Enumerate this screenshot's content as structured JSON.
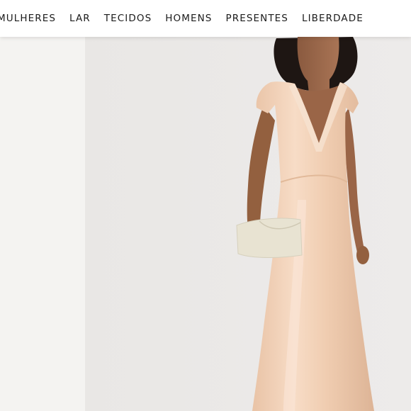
{
  "nav": {
    "items": [
      {
        "label": "MULHERES"
      },
      {
        "label": "LAR"
      },
      {
        "label": "TECIDOS"
      },
      {
        "label": "HOMENS"
      },
      {
        "label": "PRESENTES"
      },
      {
        "label": "LIBERDADE"
      }
    ]
  },
  "product": {
    "dress_color": "#f3d2b8",
    "bag_color": "#e8e3d2",
    "background_color": "#ebe9e7"
  }
}
